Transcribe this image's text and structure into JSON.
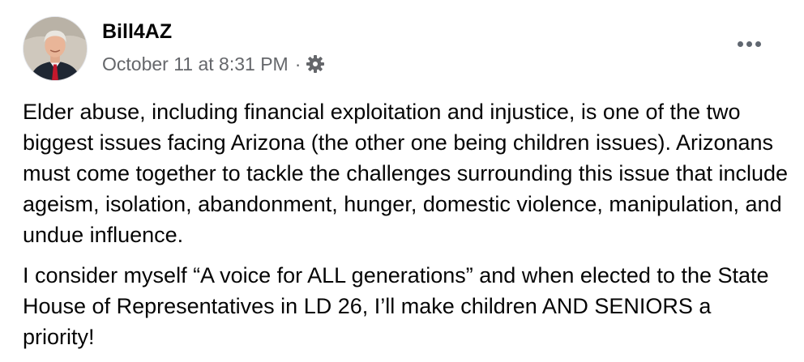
{
  "post": {
    "author": "Bill4AZ",
    "timestamp": "October 11 at 8:31 PM",
    "separator": "·",
    "privacy_icon": "gear-icon",
    "more_icon": "more-options-icon",
    "paragraphs": [
      "Elder abuse, including financial exploitation and injustice, is one of the two biggest issues facing Arizona (the other one being children issues). Arizonans must come together to tackle the challenges surrounding this issue that include ageism, isolation, abandonment, hunger, domestic violence, manipulation, and undue influence.",
      "I consider myself “A voice for ALL generations” and when elected to the State House of Representatives in LD 26, I’ll make children AND SENIORS a priority!"
    ]
  },
  "colors": {
    "text_primary": "#050505",
    "text_secondary": "#65676b",
    "icon_gray": "#606770"
  }
}
